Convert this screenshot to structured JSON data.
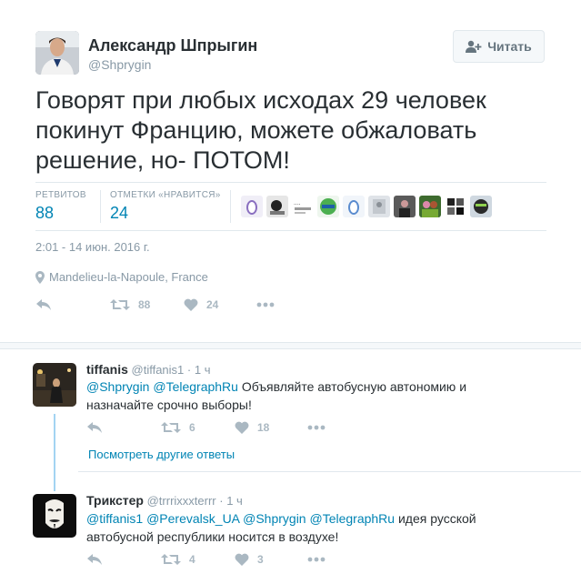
{
  "main_tweet": {
    "author_name": "Александр Шпрыгин",
    "author_handle": "@Shprygin",
    "follow_label": "Читать",
    "text": "Говорят при любых исходах 29 человек покинут Францию, можете обжаловать решение, но- ПОТОМ!",
    "retweets_label": "РЕТВИТОВ",
    "retweets_count": "88",
    "likes_label": "ОТМЕТКИ «НРАВИТСЯ»",
    "likes_count": "24",
    "timestamp": "2:01 - 14 июн. 2016 г.",
    "location": "Mandelieu-la-Napoule, France",
    "action_retweets": "88",
    "action_likes": "24",
    "likers_count_shown": 9
  },
  "replies": [
    {
      "name": "tiffanis",
      "handle": "@tiffanis1",
      "dot": "·",
      "time": "1 ч",
      "mentions": "@Shprygin @TelegraphRu",
      "text": " Объявляйте автобусную автономию и назначайте срочно выборы!",
      "retweets": "6",
      "likes": "18"
    },
    {
      "name": "Трикстер",
      "handle": "@trrrixxxterrr",
      "dot": "·",
      "time": "1 ч",
      "mentions": "@tiffanis1 @Perevalsk_UA @Shprygin @TelegraphRu",
      "text": " идея русской автобусной республики носится в воздухе!",
      "retweets": "4",
      "likes": "3"
    }
  ],
  "more_replies_label": "Посмотреть другие ответы",
  "colors": {
    "link": "#0084b4",
    "muted": "#8899a6",
    "action": "#aab8c2",
    "thread_line": "#a3d4f2"
  }
}
